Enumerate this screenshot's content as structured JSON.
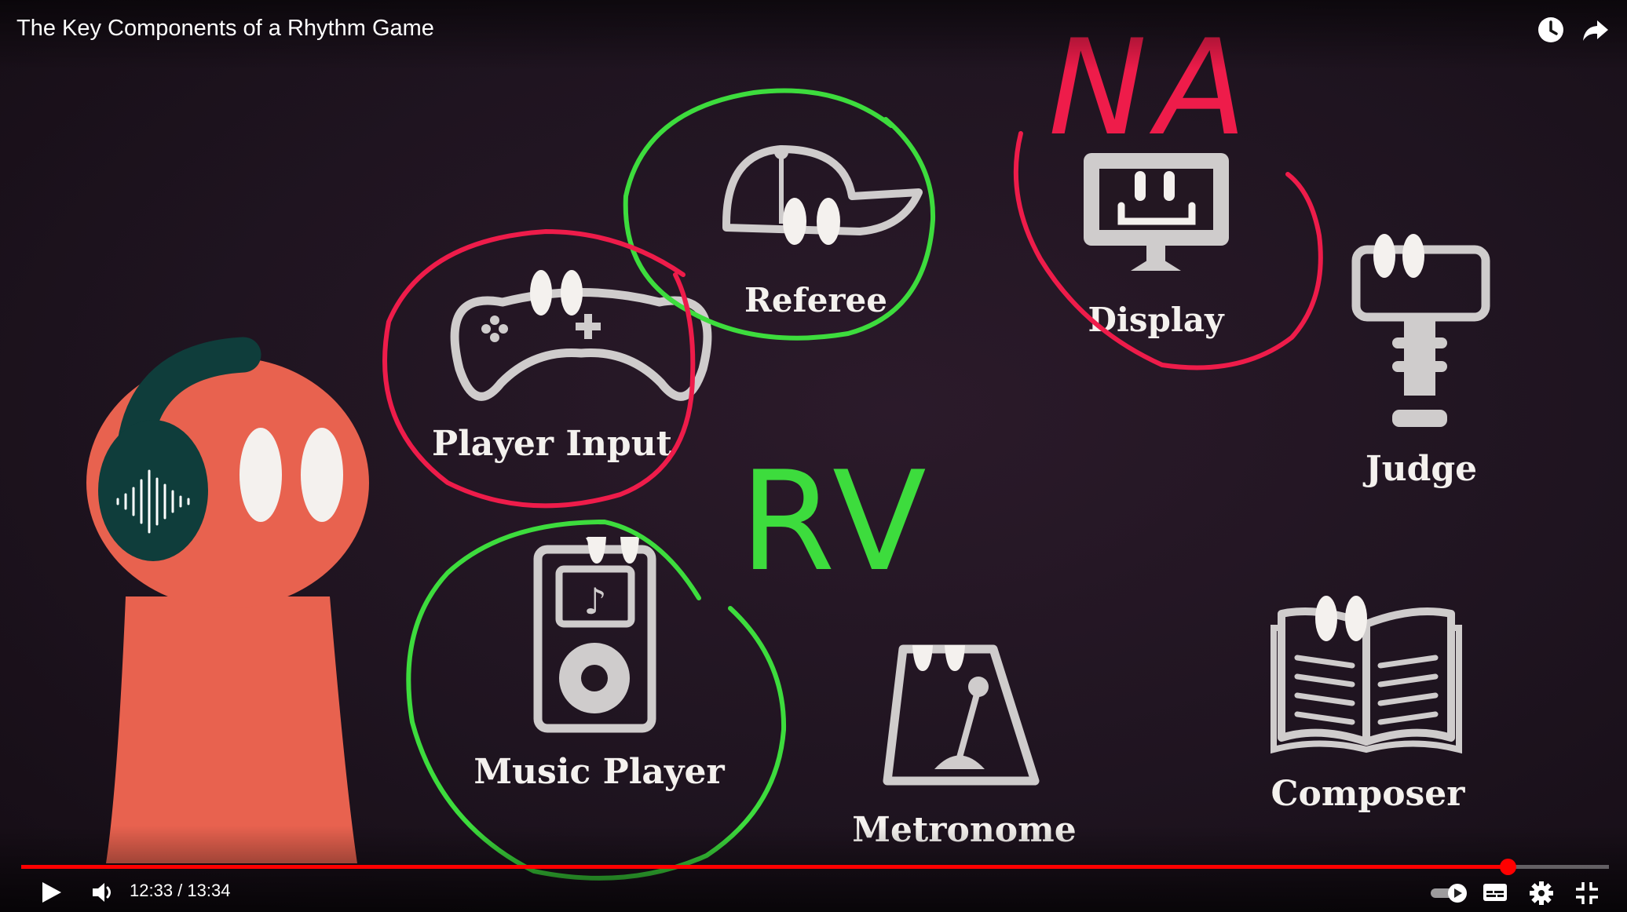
{
  "video": {
    "title": "The Key Components of a Rhythm Game"
  },
  "slide": {
    "components": [
      "Referee",
      "Display",
      "Player Input",
      "Judge",
      "Music Player",
      "Metronome",
      "Composer"
    ],
    "annotations": {
      "na": "NA",
      "rv": "RV"
    }
  },
  "player": {
    "current_time": "12:33",
    "duration": "13:34",
    "time_separator": " / ",
    "progress": 0.936,
    "autoplay": true
  },
  "icons": {
    "watch_later": "clock-icon",
    "share": "share-arrow-icon",
    "play": "play-icon",
    "volume": "volume-icon",
    "autoplay": "autoplay-toggle-icon",
    "subtitles": "subtitles-icon",
    "settings": "gear-icon",
    "exit_fullscreen": "exit-fullscreen-icon"
  },
  "colors": {
    "progress": "#ff0000",
    "annotation_green": "#3ddc3d",
    "annotation_red": "#ee1c4a",
    "character": "#e8624f",
    "headphones": "#0f3d3b",
    "icon_gray": "#cfcccc"
  }
}
